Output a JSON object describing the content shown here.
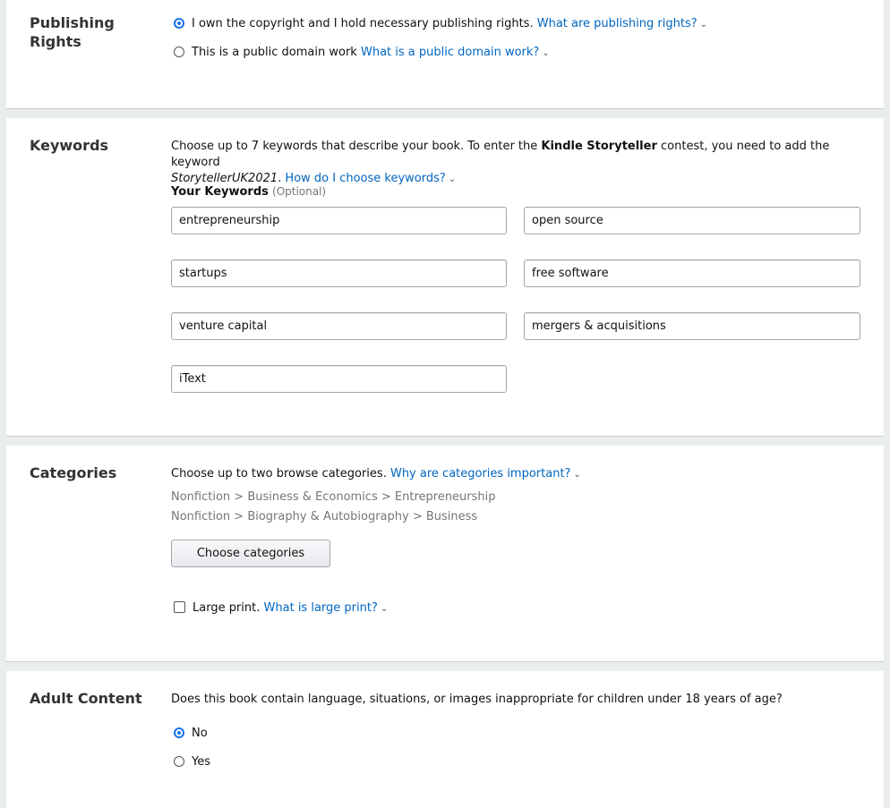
{
  "publishing_rights": {
    "title_line1": "Publishing",
    "title_line2": "Rights",
    "option_own": "I own the copyright and I hold necessary publishing rights.",
    "option_own_link": "What are publishing rights?",
    "option_public": "This is a public domain work",
    "option_public_link": "What is a public domain work?"
  },
  "keywords": {
    "title": "Keywords",
    "desc_part1": "Choose up to 7 keywords that describe your book. To enter the ",
    "desc_bold": "Kindle Storyteller",
    "desc_part2": " contest, you need to add the keyword",
    "desc_italic": "StorytellerUK2021",
    "desc_period": ".",
    "desc_link": "How do I choose keywords?",
    "your_keywords_label": "Your Keywords",
    "optional_label": "(Optional)",
    "values": [
      "entrepreneurship",
      "open source",
      "startups",
      "free software",
      "venture capital",
      "mergers & acquisitions",
      "iText"
    ]
  },
  "categories": {
    "title": "Categories",
    "desc": "Choose up to two browse categories.",
    "desc_link": "Why are categories important?",
    "selected": [
      "Nonfiction > Business & Economics > Entrepreneurship",
      "Nonfiction > Biography & Autobiography > Business"
    ],
    "choose_button": "Choose categories",
    "large_print_label": "Large print.",
    "large_print_link": "What is large print?"
  },
  "adult_content": {
    "title": "Adult Content",
    "question": "Does this book contain language, situations, or images inappropriate for children under 18 years of age?",
    "option_no": "No",
    "option_yes": "Yes"
  }
}
